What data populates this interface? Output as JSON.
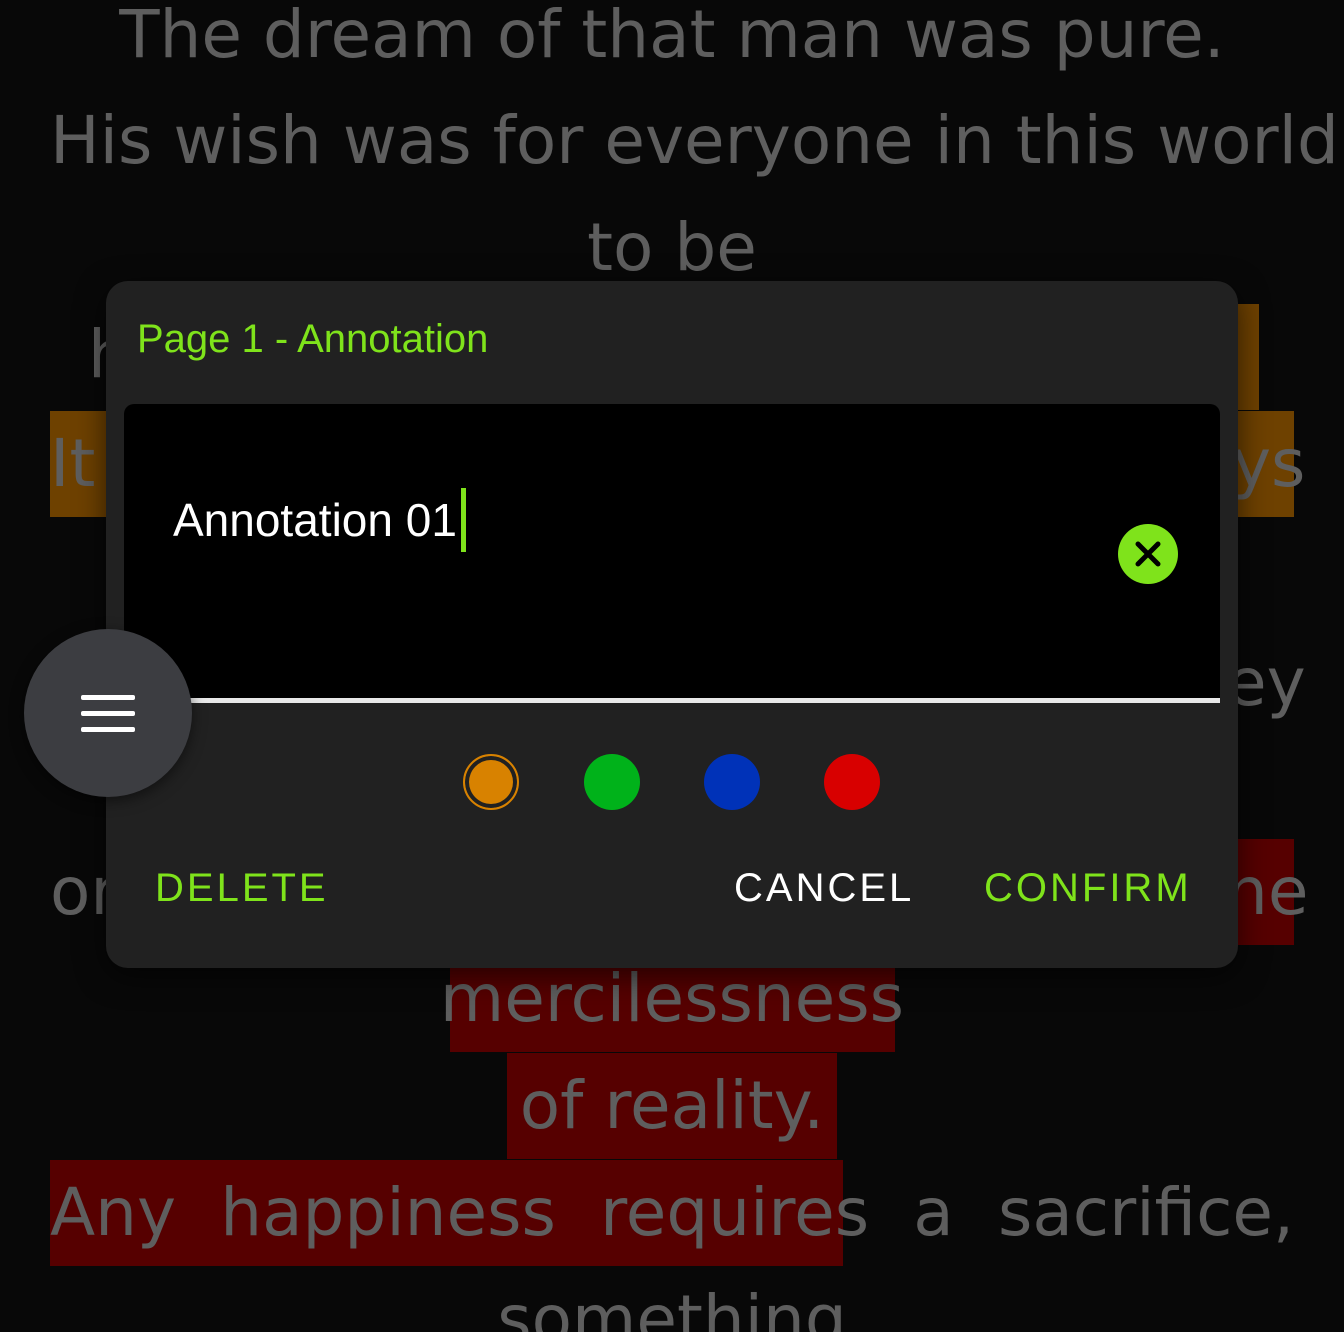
{
  "reader": {
    "line1": "The dream of that man was pure.",
    "line2": "His wish was for everyone in this world",
    "line3": "to be",
    "line4_fragment": "h",
    "line5_left": "It",
    "line5_right": "ys",
    "line7_right": "ey",
    "line9_left": "or",
    "line9_right": "ne",
    "line10": "mercilessness",
    "line11": "of reality.",
    "line12_words": [
      "Any",
      "happiness",
      "requires",
      "a",
      "sacrifice,"
    ],
    "line13": "something"
  },
  "dialog": {
    "title": "Page 1 - Annotation",
    "input_value": "Annotation 01",
    "delete_label": "DELETE",
    "cancel_label": "CANCEL",
    "confirm_label": "CONFIRM",
    "colors": [
      {
        "name": "orange",
        "hex": "#d88200",
        "selected": true
      },
      {
        "name": "green",
        "hex": "#00b21a",
        "selected": false
      },
      {
        "name": "blue",
        "hex": "#0032b8",
        "selected": false
      },
      {
        "name": "red",
        "hex": "#d80000",
        "selected": false
      }
    ],
    "accent": "#7fe31b"
  },
  "fab": {
    "icon": "menu-icon"
  }
}
